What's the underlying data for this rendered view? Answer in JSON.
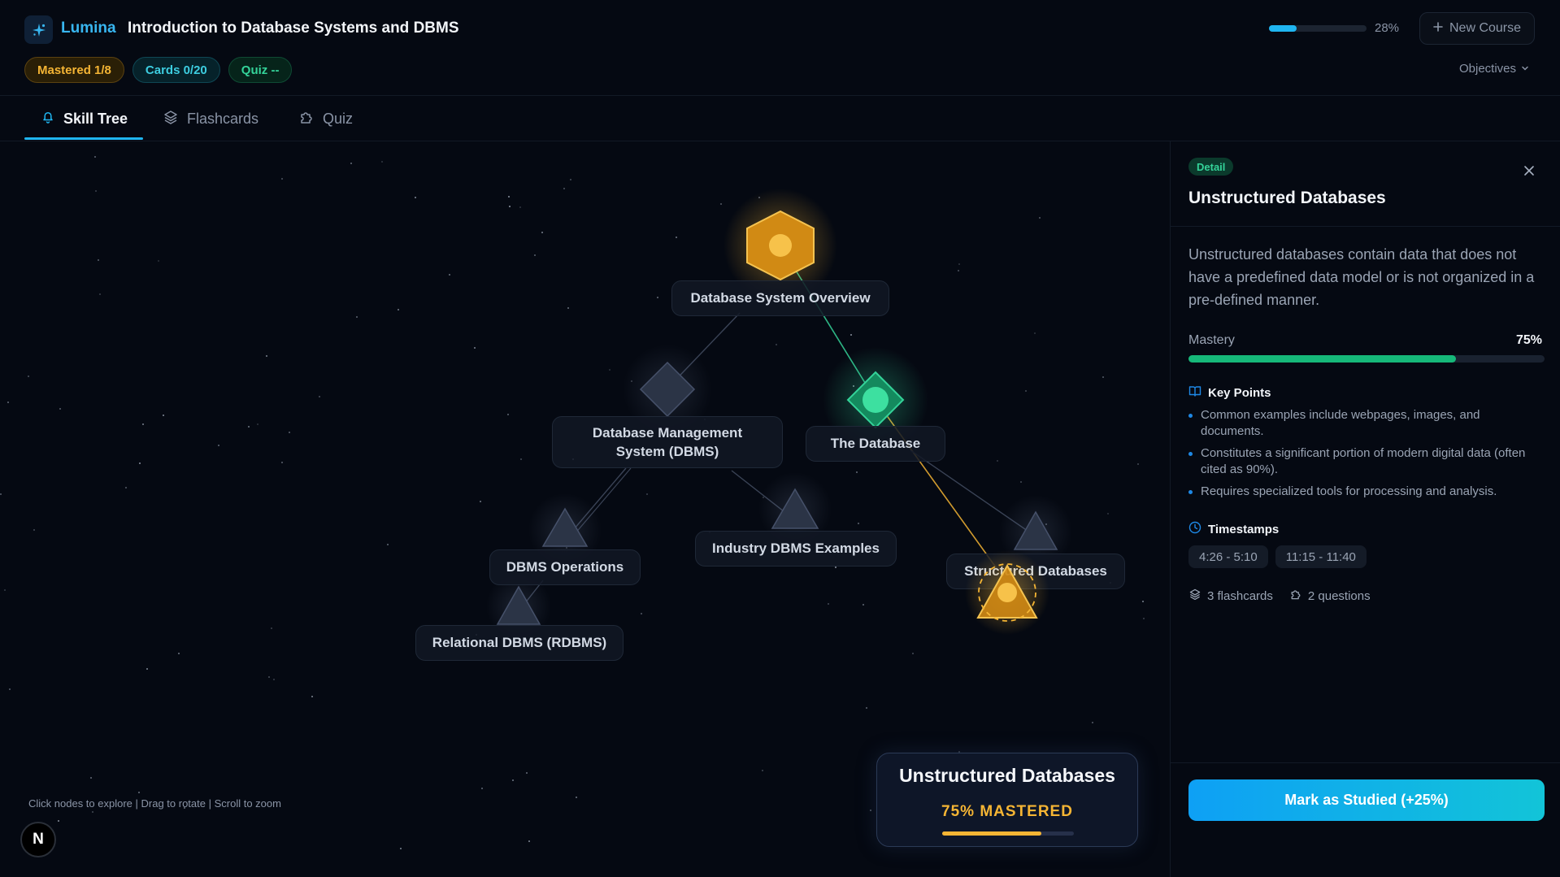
{
  "header": {
    "brand": "Lumina",
    "course_title": "Introduction to Database Systems and DBMS",
    "badges": {
      "mastered": "Mastered 1/8",
      "cards": "Cards 0/20",
      "quiz": "Quiz --"
    },
    "progress": {
      "value": 0.28,
      "label": "28%"
    },
    "new_course_label": "New Course",
    "objectives_label": "Objectives"
  },
  "tabs": [
    {
      "label": "Skill Tree",
      "icon": "bell-icon",
      "active": true
    },
    {
      "label": "Flashcards",
      "icon": "layers-icon",
      "active": false
    },
    {
      "label": "Quiz",
      "icon": "puzzle-icon",
      "active": false
    }
  ],
  "tree": {
    "nodes": {
      "overview": {
        "label": "Database System Overview",
        "shape": "hexagon",
        "status": "mastered"
      },
      "dbms": {
        "label": "Database Management System (DBMS)",
        "shape": "diamond",
        "status": "locked"
      },
      "database": {
        "label": "The Database",
        "shape": "diamond",
        "status": "available"
      },
      "ops": {
        "label": "DBMS Operations",
        "shape": "triangle",
        "status": "locked"
      },
      "industry": {
        "label": "Industry DBMS Examples",
        "shape": "triangle",
        "status": "locked"
      },
      "structured": {
        "label": "Structured Databases",
        "shape": "triangle",
        "status": "locked"
      },
      "rdbms": {
        "label": "Relational DBMS (RDBMS)",
        "shape": "triangle",
        "status": "locked"
      },
      "unstructured": {
        "label": "Unstructured Databases",
        "shape": "triangle",
        "status": "selected"
      }
    },
    "selected_card": {
      "title": "Unstructured Databases",
      "subtitle": "75% MASTERED",
      "mastery": 0.75
    },
    "hint": "Click nodes to explore | Drag to rotate | Scroll to zoom",
    "colors": {
      "mastered": "#f5b534",
      "available": "#34d399",
      "locked": "#3a4356"
    }
  },
  "panel": {
    "pill": "Detail",
    "title": "Unstructured Databases",
    "description": "Unstructured databases contain data that does not have a predefined data model or is not organized in a pre-defined manner.",
    "mastery_label": "Mastery",
    "mastery_value": "75%",
    "mastery": 0.75,
    "key_points_title": "Key Points",
    "key_points": [
      "Common examples include webpages, images, and documents.",
      "Constitutes a significant portion of modern digital data (often cited as 90%).",
      "Requires specialized tools for processing and analysis."
    ],
    "timestamps_title": "Timestamps",
    "timestamps": [
      "4:26 - 5:10",
      "11:15 - 11:40"
    ],
    "flashcards": "3 flashcards",
    "questions": "2 questions",
    "mark_button": "Mark as Studied (+25%)"
  },
  "footer_logo": "N"
}
